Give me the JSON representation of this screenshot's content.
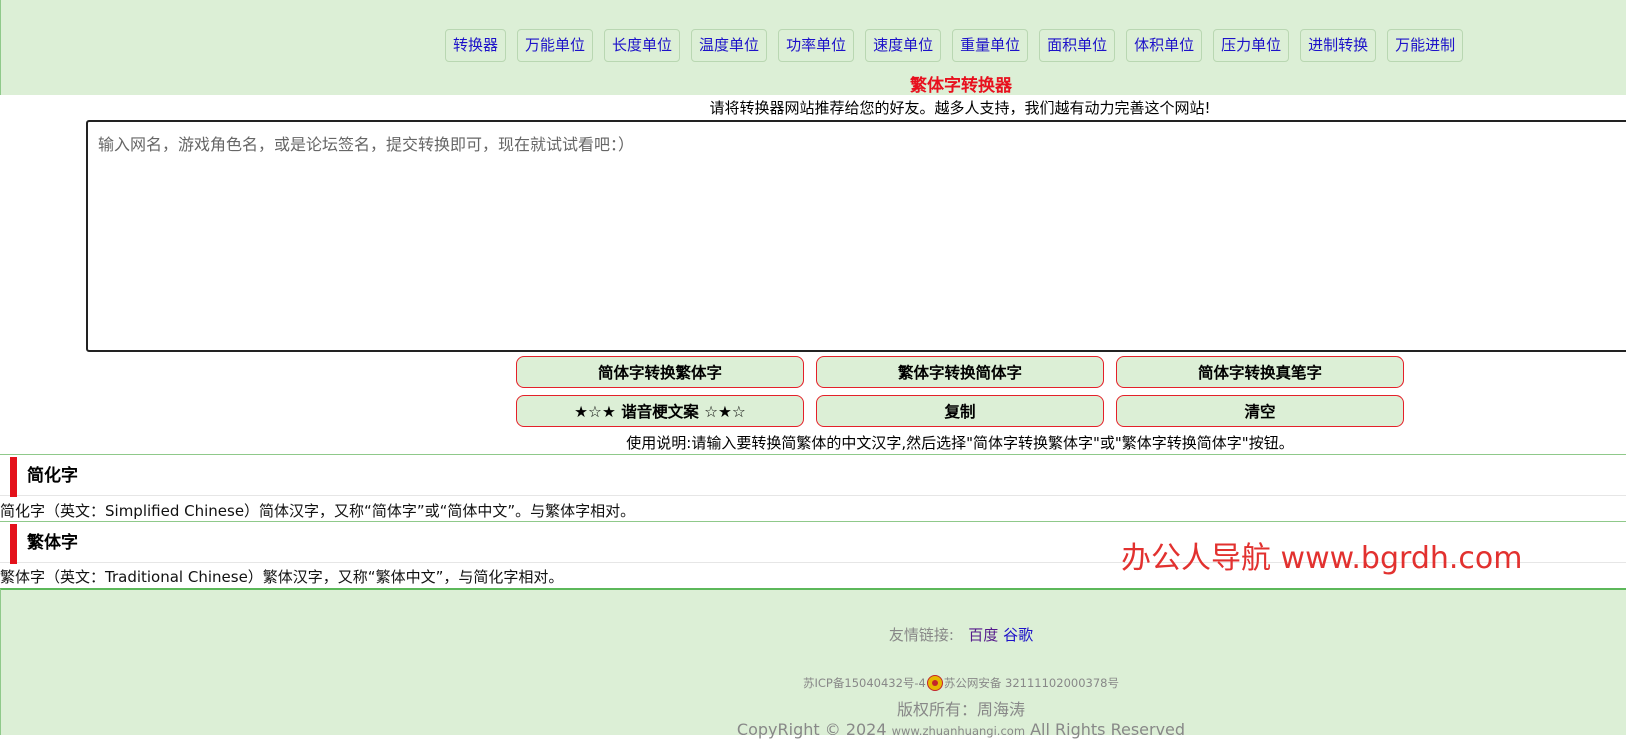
{
  "nav": [
    {
      "label": "转换器"
    },
    {
      "label": "万能单位"
    },
    {
      "label": "长度单位"
    },
    {
      "label": "温度单位"
    },
    {
      "label": "功率单位"
    },
    {
      "label": "速度单位"
    },
    {
      "label": "重量单位"
    },
    {
      "label": "面积单位"
    },
    {
      "label": "体积单位"
    },
    {
      "label": "压力单位"
    },
    {
      "label": "进制转换"
    },
    {
      "label": "万能进制"
    }
  ],
  "title": "繁体字转换器",
  "recommend": "请将转换器网站推荐给您的好友。越多人支持，我们越有动力完善这个网站!",
  "input": {
    "value": "",
    "placeholder": "输入网名，游戏角色名，或是论坛签名，提交转换即可，现在就试试看吧：）"
  },
  "buttons": {
    "to_traditional": "简体字转换繁体字",
    "to_simplified": "繁体字转换简体字",
    "to_calligraphy": "简体字转换真笔字",
    "homophone": "★☆★ 谐音梗文案 ☆★☆",
    "copy": "复制",
    "clear": "清空"
  },
  "usage": "使用说明:请输入要转换简繁体的中文汉字,然后选择\"简体字转换繁体字\"或\"繁体字转换简体字\"按钮。",
  "sections": [
    {
      "heading": "简化字",
      "text": "简化字（英文：Simplified Chinese）简体汉字，又称“简体字”或“简体中文”。与繁体字相对。"
    },
    {
      "heading": "繁体字",
      "text": "繁体字（英文：Traditional Chinese）繁体汉字，又称“繁体中文”，与简化字相对。"
    }
  ],
  "watermark": "办公人导航 www.bgrdh.com",
  "footer": {
    "friends_label": "友情链接:",
    "links": [
      "百度",
      "谷歌"
    ],
    "icp": "苏ICP备15040432号-4",
    "police": "苏公网安备 32111102000378号",
    "owner": "版权所有：周海涛",
    "copyright_prefix": "CopyRight © 2024",
    "site": "www.zhuanhuangi.com",
    "copyright_suffix": "All Rights Reserved"
  },
  "colors": {
    "band_bg": "#dcefd6",
    "accent_red": "#e4121b",
    "link_blue": "#1d12c9"
  }
}
